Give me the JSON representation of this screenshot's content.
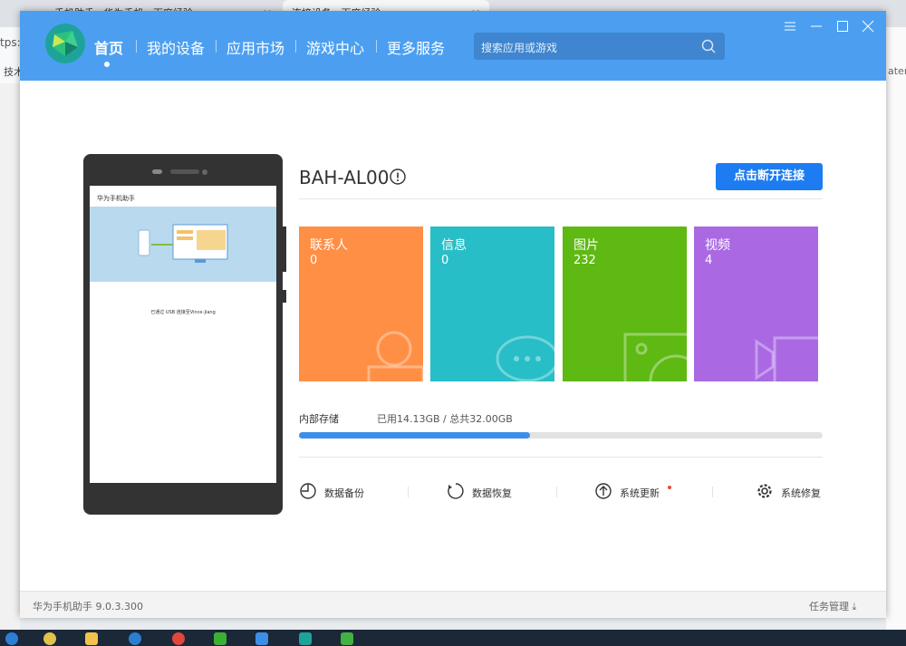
{
  "browser": {
    "tabs": [
      "手机助手 · 华为手机 · 百度经验",
      "连接设备 · 百度经验"
    ],
    "address_fragment": "tps:/",
    "bookmark_fragment": "技术",
    "right_fragment": "ater"
  },
  "app": {
    "nav": [
      "首页",
      "我的设备",
      "应用市场",
      "游戏中心",
      "更多服务"
    ],
    "search_placeholder": "搜索应用或游戏",
    "device_model": "BAH-AL00",
    "disconnect_label": "点击断开连接",
    "phone_screen": {
      "app_title": "华为手机助手",
      "connection_text": "已通过 USB 连接至Vince-Jiang"
    },
    "tiles": [
      {
        "label": "联系人",
        "value": "0",
        "color": "#ff8f45"
      },
      {
        "label": "信息",
        "value": "0",
        "color": "#27bec7"
      },
      {
        "label": "图片",
        "value": "232",
        "color": "#5eb913"
      },
      {
        "label": "视频",
        "value": "4",
        "color": "#aa69e3"
      }
    ],
    "storage": {
      "label": "内部存储",
      "value_text": "已用14.13GB / 总共32.00GB",
      "used_fraction": 0.4416
    },
    "actions": [
      "数据备份",
      "数据恢复",
      "系统更新",
      "系统修复"
    ],
    "version": "华为手机助手 9.0.3.300",
    "task_manager": "任务管理",
    "colors": {
      "header": "#4c9ff0",
      "accent": "#1d7cf2"
    }
  }
}
